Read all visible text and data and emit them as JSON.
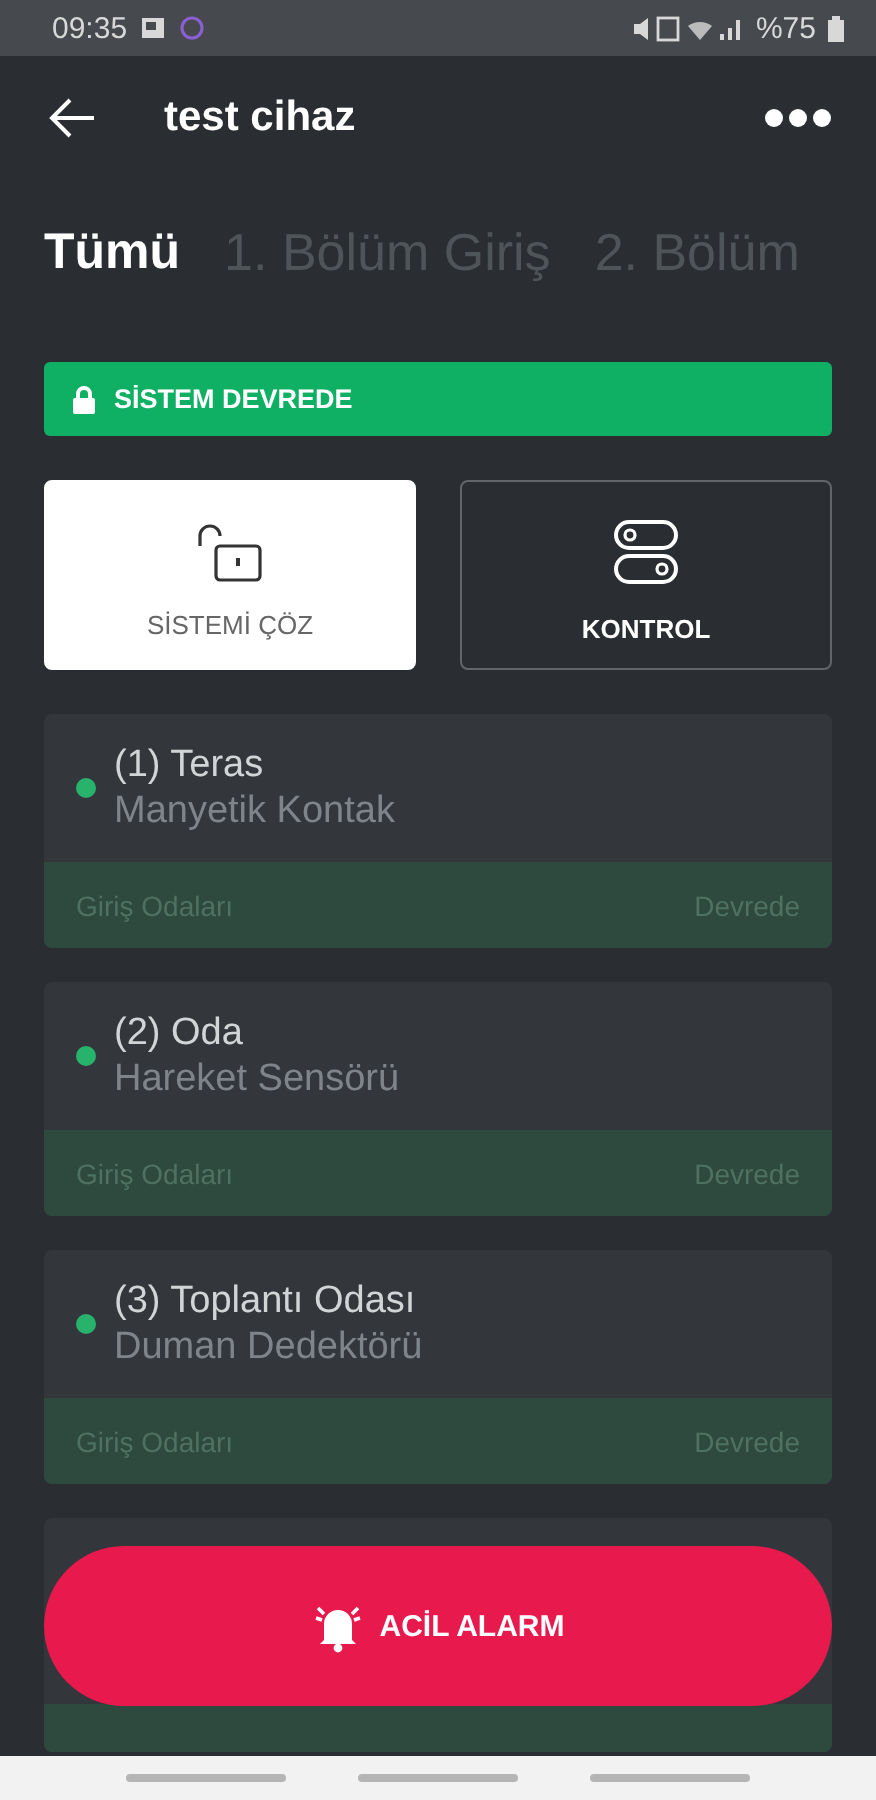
{
  "status_bar": {
    "time": "09:35",
    "battery": "%75"
  },
  "app_bar": {
    "title": "test cihaz"
  },
  "tabs": [
    {
      "label": "Tümü",
      "selected": true
    },
    {
      "label": "1. Bölüm Giriş",
      "selected": false
    },
    {
      "label": "2. Bölüm",
      "selected": false
    }
  ],
  "banner": {
    "text": "SİSTEM DEVREDE",
    "armed": true
  },
  "actions": [
    {
      "kind": "unlock",
      "label": "SİSTEMİ ÇÖZ",
      "selected": true
    },
    {
      "kind": "control",
      "label": "KONTROL",
      "selected": false
    }
  ],
  "zones": [
    {
      "title": "(1) Teras",
      "subtitle": "Manyetik Kontak",
      "group": "Giriş Odaları",
      "state": "Devrede",
      "color": "#27b36b"
    },
    {
      "title": "(2) Oda",
      "subtitle": "Hareket Sensörü",
      "group": "Giriş Odaları",
      "state": "Devrede",
      "color": "#27b36b"
    },
    {
      "title": "(3) Toplantı Odası",
      "subtitle": "Duman Dedektörü",
      "group": "Giriş Odaları",
      "state": "Devrede",
      "color": "#27b36b"
    }
  ],
  "alarm_button": {
    "label": "ACİL ALARM"
  }
}
